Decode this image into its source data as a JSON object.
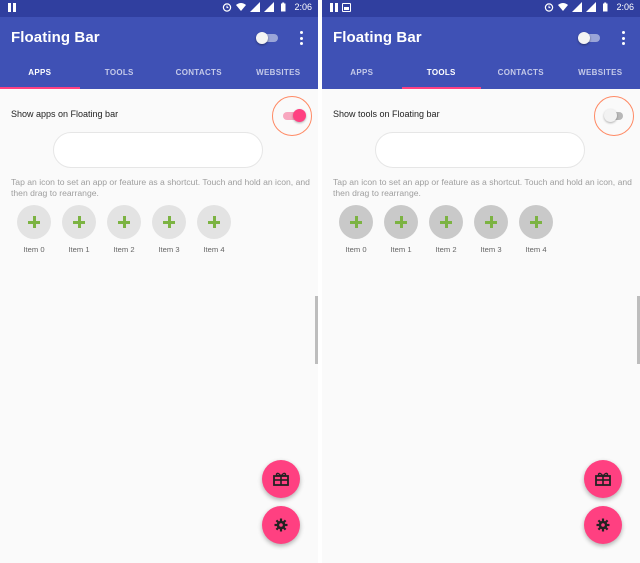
{
  "colors": {
    "status_bar": "#303f9f",
    "primary": "#3f51b5",
    "accent": "#ff4081",
    "plus_green": "#7cb342",
    "highlight_ring": "#ff8a65"
  },
  "status_bar": {
    "time": "2:06",
    "icons": [
      "pause-icon",
      "alarm-icon",
      "wifi-icon",
      "signal-icon",
      "signal-icon",
      "battery-icon"
    ]
  },
  "screens": [
    {
      "app_title": "Floating Bar",
      "tabs": [
        {
          "label": "APPS",
          "active": true
        },
        {
          "label": "TOOLS",
          "active": false
        },
        {
          "label": "CONTACTS",
          "active": false
        },
        {
          "label": "WEBSITES",
          "active": false
        }
      ],
      "toggle_label": "Show apps on Floating bar",
      "toggle_state": "on",
      "hint": "Tap an icon to set an app or feature as a shortcut. Touch and hold an icon, and then drag to rearrange.",
      "items": [
        "Item 0",
        "Item 1",
        "Item 2",
        "Item 3",
        "Item 4"
      ],
      "fabs": [
        "gift-icon",
        "gear-icon"
      ]
    },
    {
      "app_title": "Floating Bar",
      "tabs": [
        {
          "label": "APPS",
          "active": false
        },
        {
          "label": "TOOLS",
          "active": true
        },
        {
          "label": "CONTACTS",
          "active": false
        },
        {
          "label": "WEBSITES",
          "active": false
        }
      ],
      "toggle_label": "Show tools on Floating bar",
      "toggle_state": "off",
      "hint": "Tap an icon to set an app or feature as a shortcut. Touch and hold an icon, and then drag to rearrange.",
      "items": [
        "Item 0",
        "Item 1",
        "Item 2",
        "Item 3",
        "Item 4"
      ],
      "fabs": [
        "gift-icon",
        "gear-icon"
      ]
    }
  ]
}
